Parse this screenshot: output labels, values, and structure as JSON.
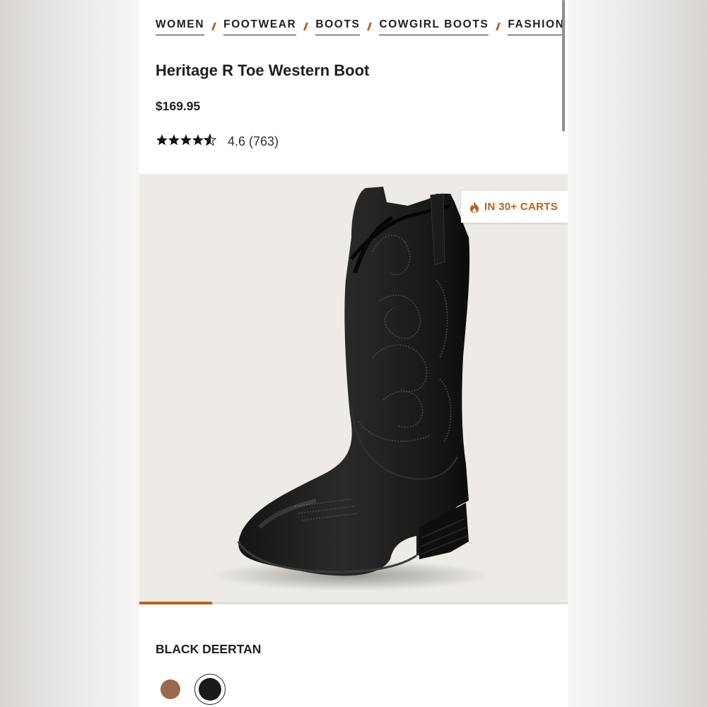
{
  "breadcrumb": {
    "items": [
      "WOMEN",
      "FOOTWEAR",
      "BOOTS",
      "COWGIRL BOOTS",
      "FASHION"
    ]
  },
  "product": {
    "title": "Heritage R Toe Western Boot",
    "price": "$169.95",
    "rating": {
      "stars": "★★★★★",
      "value": 4.6,
      "text": "4.6 (763)"
    }
  },
  "badge": {
    "icon": "flame-icon",
    "text": "IN 30+ CARTS"
  },
  "gallery": {
    "progress": 0.17
  },
  "color": {
    "selected_label": "BLACK DEERTAN",
    "swatches": [
      {
        "name": "brown",
        "color": "#9b6a4a",
        "selected": false
      },
      {
        "name": "black",
        "color": "#1b1b1b",
        "selected": true
      }
    ]
  },
  "colors": {
    "accent": "#b8601e",
    "text": "#1f1f1f"
  }
}
